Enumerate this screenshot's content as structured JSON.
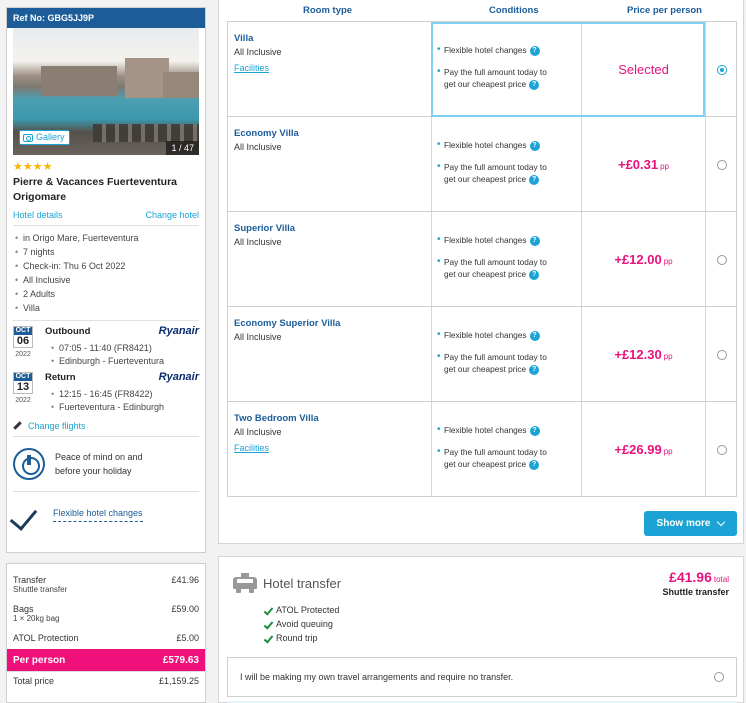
{
  "sidebar": {
    "ref": "Ref No: GBG5JJ9P",
    "gallery_label": "Gallery",
    "photo_counter": "1 / 47",
    "stars": "★★★★",
    "star_rating": 4,
    "hotel_name": "Pierre & Vacances Fuerteventura Origomare",
    "hotel_details_link": "Hotel details",
    "change_hotel_link": "Change hotel",
    "details": [
      "in Origo Mare, Fuerteventura",
      "7 nights",
      "Check-in: Thu 6 Oct 2022",
      "All Inclusive",
      "2 Adults",
      "Villa"
    ],
    "outbound": {
      "month": "OCT",
      "day": "06",
      "year": "2022",
      "title": "Outbound",
      "airline": "Ryanair",
      "time": "07:05 - 11:40 (FR8421)",
      "route": "Edinburgh - Fuerteventura"
    },
    "return": {
      "month": "OCT",
      "day": "13",
      "year": "2022",
      "title": "Return",
      "airline": "Ryanair",
      "time": "12:15 - 16:45 (FR8422)",
      "route": "Fuerteventura - Edinburgh"
    },
    "change_flights": "Change flights",
    "peace_line1": "Peace of mind on and",
    "peace_line2": "before your holiday",
    "flexible_link": "Flexible hotel changes"
  },
  "price_summary": {
    "transfer_label": "Transfer",
    "transfer_value": "£41.96",
    "transfer_sub": "Shuttle transfer",
    "bags_label": "Bags",
    "bags_value": "£59.00",
    "bags_sub": "1 × 20kg bag",
    "atol_label": "ATOL Protection",
    "atol_value": "£5.00",
    "per_person_label": "Per person",
    "per_person_value": "£579.63",
    "total_label": "Total price",
    "total_value": "£1,159.25"
  },
  "table": {
    "headers": {
      "room_type": "Room type",
      "conditions": "Conditions",
      "price": "Price per person"
    },
    "cond1": "Flexible hotel changes",
    "cond2a": "Pay the full amount today to",
    "cond2b": "get our cheapest price",
    "pp": "pp",
    "selected_text": "Selected",
    "rooms": [
      {
        "name": "Villa",
        "board": "All Inclusive",
        "facilities": "Facilities",
        "price": "",
        "selected": true
      },
      {
        "name": "Economy Villa",
        "board": "All Inclusive",
        "facilities": "",
        "price": "+£0.31",
        "selected": false
      },
      {
        "name": "Superior Villa",
        "board": "All Inclusive",
        "facilities": "",
        "price": "+£12.00",
        "selected": false
      },
      {
        "name": "Economy Superior Villa",
        "board": "All Inclusive",
        "facilities": "",
        "price": "+£12.30",
        "selected": false
      },
      {
        "name": "Two Bedroom Villa",
        "board": "All Inclusive",
        "facilities": "Facilities",
        "price": "+£26.99",
        "selected": false
      }
    ],
    "show_more": "Show more"
  },
  "transfer": {
    "title": "Hotel transfer",
    "price": "£41.96",
    "total": "total",
    "type": "Shuttle transfer",
    "features": [
      "ATOL Protected",
      "Avoid queuing",
      "Round trip"
    ],
    "own_arrangements": "I will be making my own travel arrangements and require no transfer."
  },
  "colors": {
    "brand_blue": "#1c5d99",
    "accent_cyan": "#1aa3d4",
    "price_pink": "#e8127c",
    "per_person_bg": "#f0107b"
  }
}
